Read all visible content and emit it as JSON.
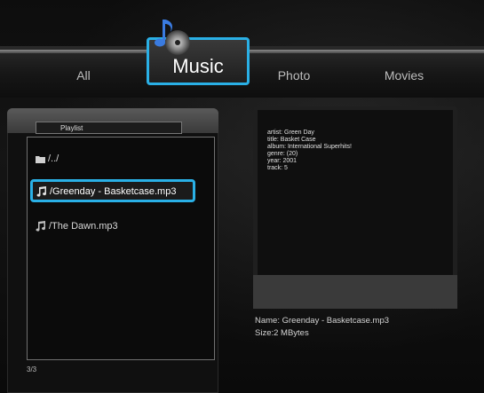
{
  "tabs": [
    {
      "label": "All"
    },
    {
      "label": "Music",
      "selected": true
    },
    {
      "label": "Photo"
    },
    {
      "label": "Movies"
    }
  ],
  "playlist": {
    "title": "Playlist",
    "items": [
      {
        "label": "/../",
        "icon": "folder-icon"
      },
      {
        "label": "/Greenday - Basketcase.mp3",
        "icon": "music-note-icon",
        "selected": true
      },
      {
        "label": "/The Dawn.mp3",
        "icon": "music-note-icon"
      }
    ],
    "page_count": "3/3"
  },
  "info": {
    "artist": "artist: Green Day",
    "title": "title: Basket Case",
    "album": "album: International Superhits!",
    "genre": "genre: (20)",
    "year": "year: 2001",
    "track": "track: 5",
    "name": "Name: Greenday - Basketcase.mp3",
    "size": "Size:2 MBytes"
  },
  "colors": {
    "accent": "#2ab0e6",
    "background": "#0d0d0d",
    "text": "#d8d8d8"
  }
}
